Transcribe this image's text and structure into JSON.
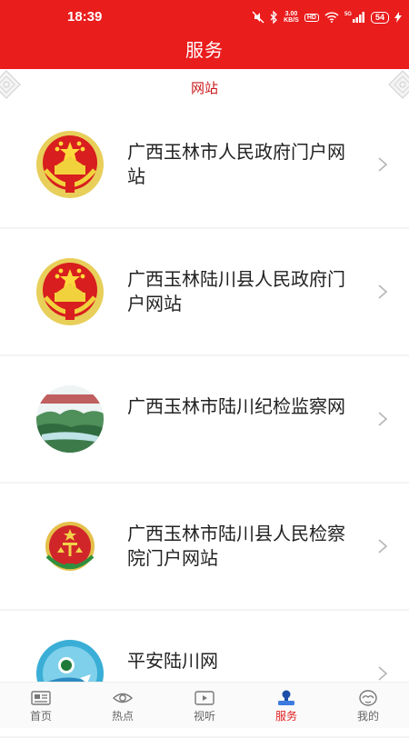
{
  "status_bar": {
    "time": "18:39",
    "speed_value": "3.00",
    "speed_unit": "KB/S",
    "hd": "HD",
    "network": "5G",
    "battery": "54"
  },
  "header": {
    "title": "服务"
  },
  "section": {
    "label": "网站"
  },
  "items": [
    {
      "title": "广西玉林市人民政府门户网站",
      "icon": "national-emblem-icon"
    },
    {
      "title": "广西玉林陆川县人民政府门户网站",
      "icon": "national-emblem-icon"
    },
    {
      "title": "广西玉林市陆川纪检监察网",
      "icon": "landscape-logo-icon"
    },
    {
      "title": "广西玉林市陆川县人民检察院门户网站",
      "icon": "procuratorate-emblem-icon"
    },
    {
      "title": "平安陆川网",
      "icon": "police-logo-icon"
    }
  ],
  "bottom_nav": [
    {
      "label": "首页",
      "icon": "newspaper-icon"
    },
    {
      "label": "热点",
      "icon": "eye-icon"
    },
    {
      "label": "视听",
      "icon": "video-play-icon"
    },
    {
      "label": "服务",
      "icon": "service-stamp-icon",
      "active": true
    },
    {
      "label": "我的",
      "icon": "profile-face-icon"
    }
  ],
  "colors": {
    "brand_red": "#ea1d1d",
    "section_red": "#c9181b",
    "active_nav": "#e02020"
  }
}
